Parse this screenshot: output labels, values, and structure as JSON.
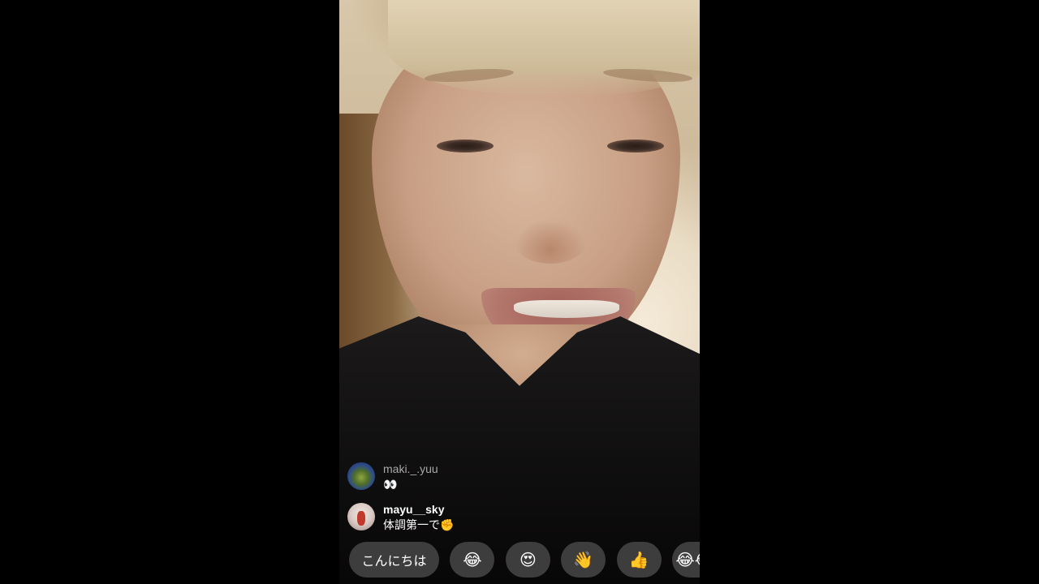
{
  "live_comments": [
    {
      "username": "maki._.yuu",
      "message": "👀"
    },
    {
      "username": "mayu__sky",
      "message": "体調第一で✊"
    }
  ],
  "quick_reactions": [
    {
      "label": "こんにちは"
    },
    {
      "label": "😂"
    },
    {
      "label": "😍"
    },
    {
      "label": "👋"
    },
    {
      "label": "👍"
    },
    {
      "label": "😂😂"
    }
  ],
  "colors": {
    "background": "#000000",
    "chip_background": "#464646",
    "text": "#ffffff",
    "dim_username": "#a8a8a8"
  }
}
